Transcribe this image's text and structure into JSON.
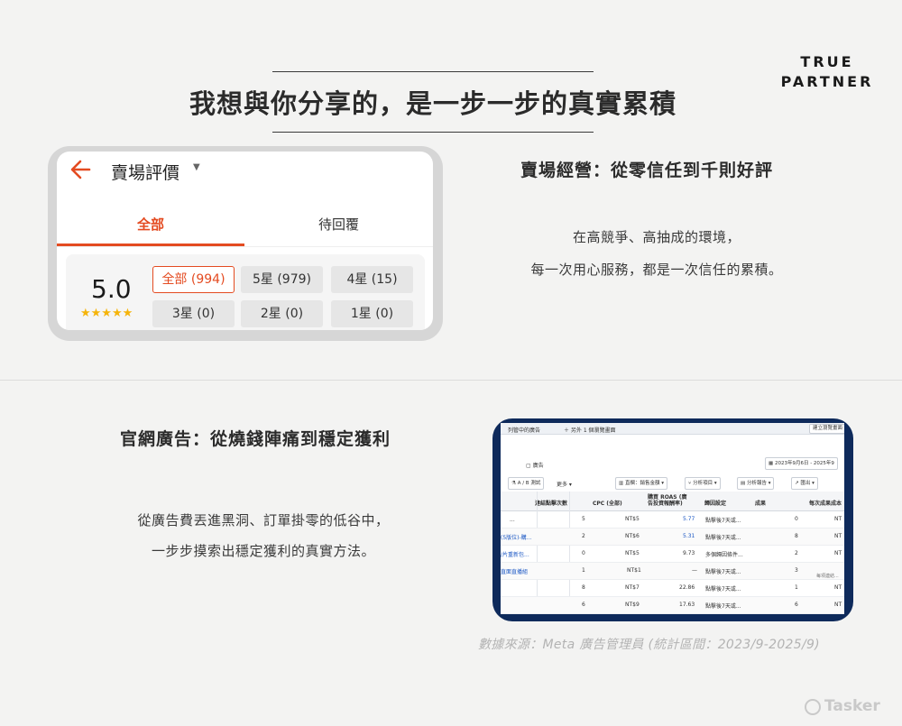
{
  "headline": "我想與你分享的，是一步一步的真實累積",
  "logo": {
    "line1": "TRUE",
    "line2": "PARTNER"
  },
  "review_card": {
    "title": "賣場評價",
    "tabs": [
      "全部",
      "待回覆"
    ],
    "score": "5.0",
    "stars": "★★★★★",
    "filters": [
      "全部 (994)",
      "5星 (979)",
      "4星 (15)",
      "3星 (0)",
      "2星 (0)",
      "1星 (0)"
    ]
  },
  "section1": {
    "title": "賣場經營：從零信任到千則好評",
    "line1": "在高競爭、高抽成的環境，",
    "line2": "每一次用心服務，都是一次信任的累積。"
  },
  "section2": {
    "title": "官網廣告：從燒錢陣痛到穩定獲利",
    "line1": "從廣告費丟進黑洞、訂單掛零的低谷中，",
    "line2": "一步步摸索出穩定獲利的真實方法。"
  },
  "ads_manager": {
    "top_tabs": [
      "列管中的廣告",
      "＋ 另外 1 個瀏覽畫面"
    ],
    "top_right": "建立瀏覽畫面",
    "section": "廣告",
    "date_range": "2023年9月6日 - 2025年9",
    "toolbar": [
      "A / B 測試",
      "更多",
      "直欄：銷售金額",
      "分析項目",
      "分析報告",
      "匯出"
    ],
    "columns": [
      "連結點擊次數",
      "CPC (全部)",
      "購買 ROAS (廣告投資報酬率)",
      "歸因設定",
      "成果",
      "每次成果成本"
    ],
    "rows": [
      {
        "name": "...",
        "clicks": "5",
        "cpc": "NT$5",
        "roas": "5.77",
        "attr": "點擊後7天或...",
        "result": "0",
        "cost": "NT"
      },
      {
        "name": "(5版位)-購...",
        "clicks": "2",
        "cpc": "NT$6",
        "roas": "5.31",
        "attr": "點擊後7天或...",
        "result": "8",
        "cost": "NT"
      },
      {
        "name": "/片重新包...",
        "clicks": "0",
        "cpc": "NT$5",
        "roas": "9.73",
        "attr": "多個歸因條件...",
        "result": "2",
        "cost": "NT"
      },
      {
        "name": "直面直播組",
        "clicks": "1",
        "cpc": "NT$1",
        "roas": "—",
        "attr": "點擊後7天或...",
        "result": "3",
        "cost": "每項連結..."
      },
      {
        "name": "",
        "clicks": "8",
        "cpc": "NT$7",
        "roas": "22.86",
        "attr": "點擊後7天或...",
        "result": "1",
        "cost": "NT"
      },
      {
        "name": "",
        "clicks": "6",
        "cpc": "NT$9",
        "roas": "17.63",
        "attr": "點擊後7天或...",
        "result": "6",
        "cost": "NT"
      }
    ]
  },
  "source_note": "數據來源：Meta 廣告管理員 (統計區間：2023/9-2025/9)",
  "brand": "Tasker",
  "colors": {
    "accent": "#e44b21",
    "star": "#f5b40b",
    "frame_dark": "#0e2a5b"
  }
}
